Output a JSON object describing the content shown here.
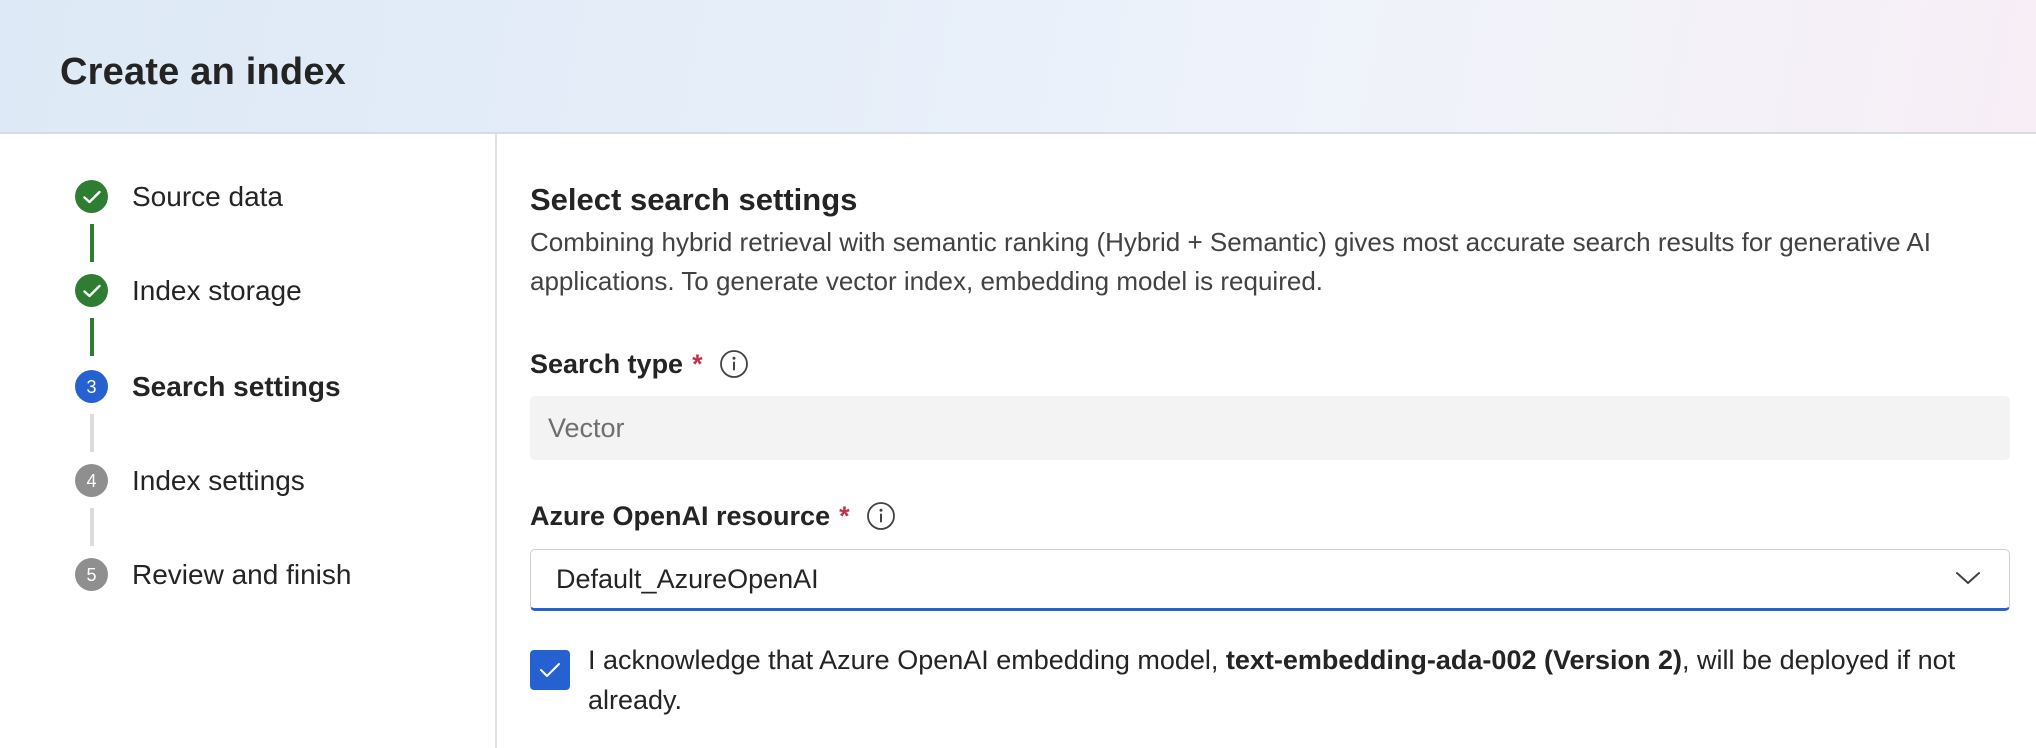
{
  "header": {
    "title": "Create an index"
  },
  "steps": [
    {
      "label": "Source data",
      "status": "done",
      "marker": ""
    },
    {
      "label": "Index storage",
      "status": "done",
      "marker": ""
    },
    {
      "label": "Search settings",
      "status": "current",
      "marker": "3"
    },
    {
      "label": "Index settings",
      "status": "pending",
      "marker": "4"
    },
    {
      "label": "Review and finish",
      "status": "pending",
      "marker": "5"
    }
  ],
  "main": {
    "section_title": "Select search settings",
    "section_description": "Combining hybrid retrieval with semantic ranking (Hybrid + Semantic) gives most accurate search results for generative AI applications. To generate vector index, embedding model is required.",
    "search_type": {
      "label": "Search type",
      "required_mark": "*",
      "value": "Vector"
    },
    "openai_resource": {
      "label": "Azure OpenAI resource",
      "required_mark": "*",
      "value": "Default_AzureOpenAI"
    },
    "acknowledge": {
      "checked": true,
      "text_before": "I acknowledge that Azure OpenAI embedding model, ",
      "model_name": "text-embedding-ada-002 (Version 2)",
      "text_after": ", will be deployed if not already."
    }
  },
  "colors": {
    "step_done": "#2e7d32",
    "step_current": "#2561d0",
    "step_pending": "#8f8f8f",
    "accent": "#2561d0",
    "required": "#c4314b"
  },
  "icons": {
    "step_done": "checkmark-icon",
    "info": "info-icon",
    "dropdown": "chevron-down-icon",
    "checkbox": "checkmark-icon"
  }
}
